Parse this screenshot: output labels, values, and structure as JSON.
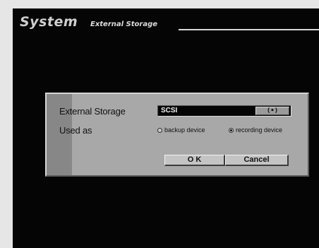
{
  "header": {
    "title": "System",
    "subtitle": "External Storage"
  },
  "dialog": {
    "storage_label": "External Storage",
    "storage_value": "SCSI",
    "storage_button": "(•)",
    "used_as_label": "Used as",
    "options": [
      {
        "label": "backup device",
        "checked": false
      },
      {
        "label": "recording device",
        "checked": true
      }
    ],
    "ok_label": "O K",
    "cancel_label": "Cancel"
  }
}
